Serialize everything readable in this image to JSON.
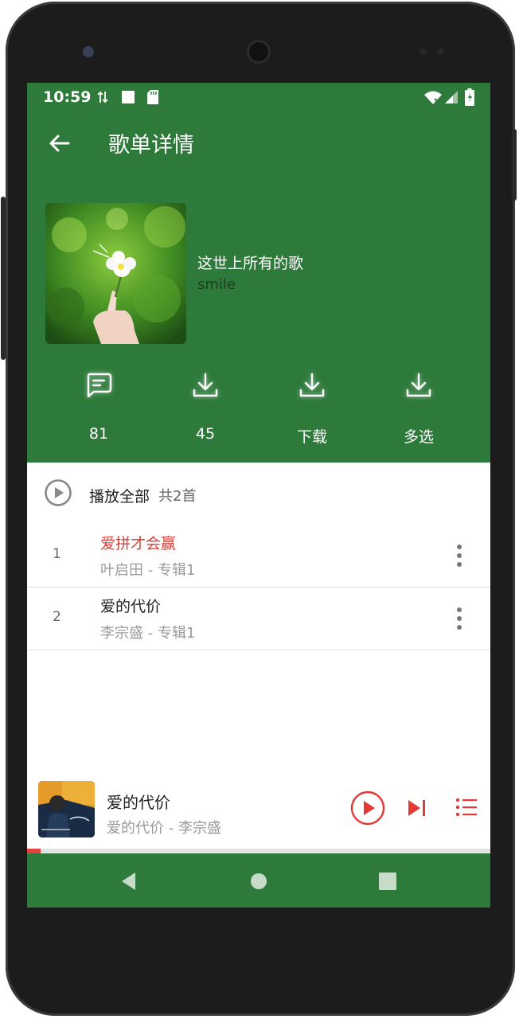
{
  "status_bar": {
    "time": "10:59"
  },
  "toolbar": {
    "title": "歌单详情"
  },
  "playlist": {
    "name": "这世上所有的歌",
    "author": "smile"
  },
  "actions": [
    {
      "label": "81",
      "icon": "comment-icon"
    },
    {
      "label": "45",
      "icon": "download-icon"
    },
    {
      "label": "下载",
      "icon": "download-icon"
    },
    {
      "label": "多选",
      "icon": "download-icon"
    }
  ],
  "play_all": {
    "label": "播放全部",
    "count": "共2首"
  },
  "songs": [
    {
      "index": "1",
      "title": "爱拼才会赢",
      "subtitle": "叶启田 - 专辑1",
      "title_color": "#d9423a"
    },
    {
      "index": "2",
      "title": "爱的代价",
      "subtitle": "李宗盛 - 专辑1",
      "title_color": "#222222"
    }
  ],
  "now_playing": {
    "title": "爱的代价",
    "subtitle": "爱的代价 - 李宗盛",
    "progress": 0.03
  },
  "colors": {
    "primary": "#2e7a3b",
    "accent": "#e53935"
  }
}
